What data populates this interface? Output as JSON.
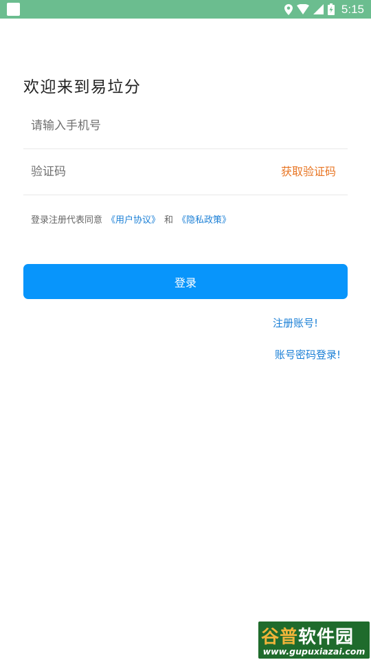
{
  "status_bar": {
    "time": "5:15",
    "background_color": "#6bbd8f",
    "icons": [
      "app-notification-icon",
      "location-icon",
      "wifi-icon",
      "signal-icon",
      "battery-charging-icon"
    ]
  },
  "login": {
    "welcome_title": "欢迎来到易垃分",
    "phone_placeholder": "请输入手机号",
    "code_placeholder": "验证码",
    "get_code_label": "获取验证码",
    "agreement_prefix": "登录注册代表同意",
    "user_agreement_link": "《用户协议》",
    "agreement_and": "和",
    "privacy_policy_link": "《隐私政策》",
    "login_button_label": "登录",
    "register_link": "注册账号!",
    "password_login_link": "账号密码登录!"
  },
  "colors": {
    "primary": "#0895fb",
    "link": "#1a7fd6",
    "get_code": "#e87523"
  },
  "watermark": {
    "line1_part1": "谷普",
    "line1_part2": "软件园",
    "line2": "www.gupuxiazai.com"
  }
}
